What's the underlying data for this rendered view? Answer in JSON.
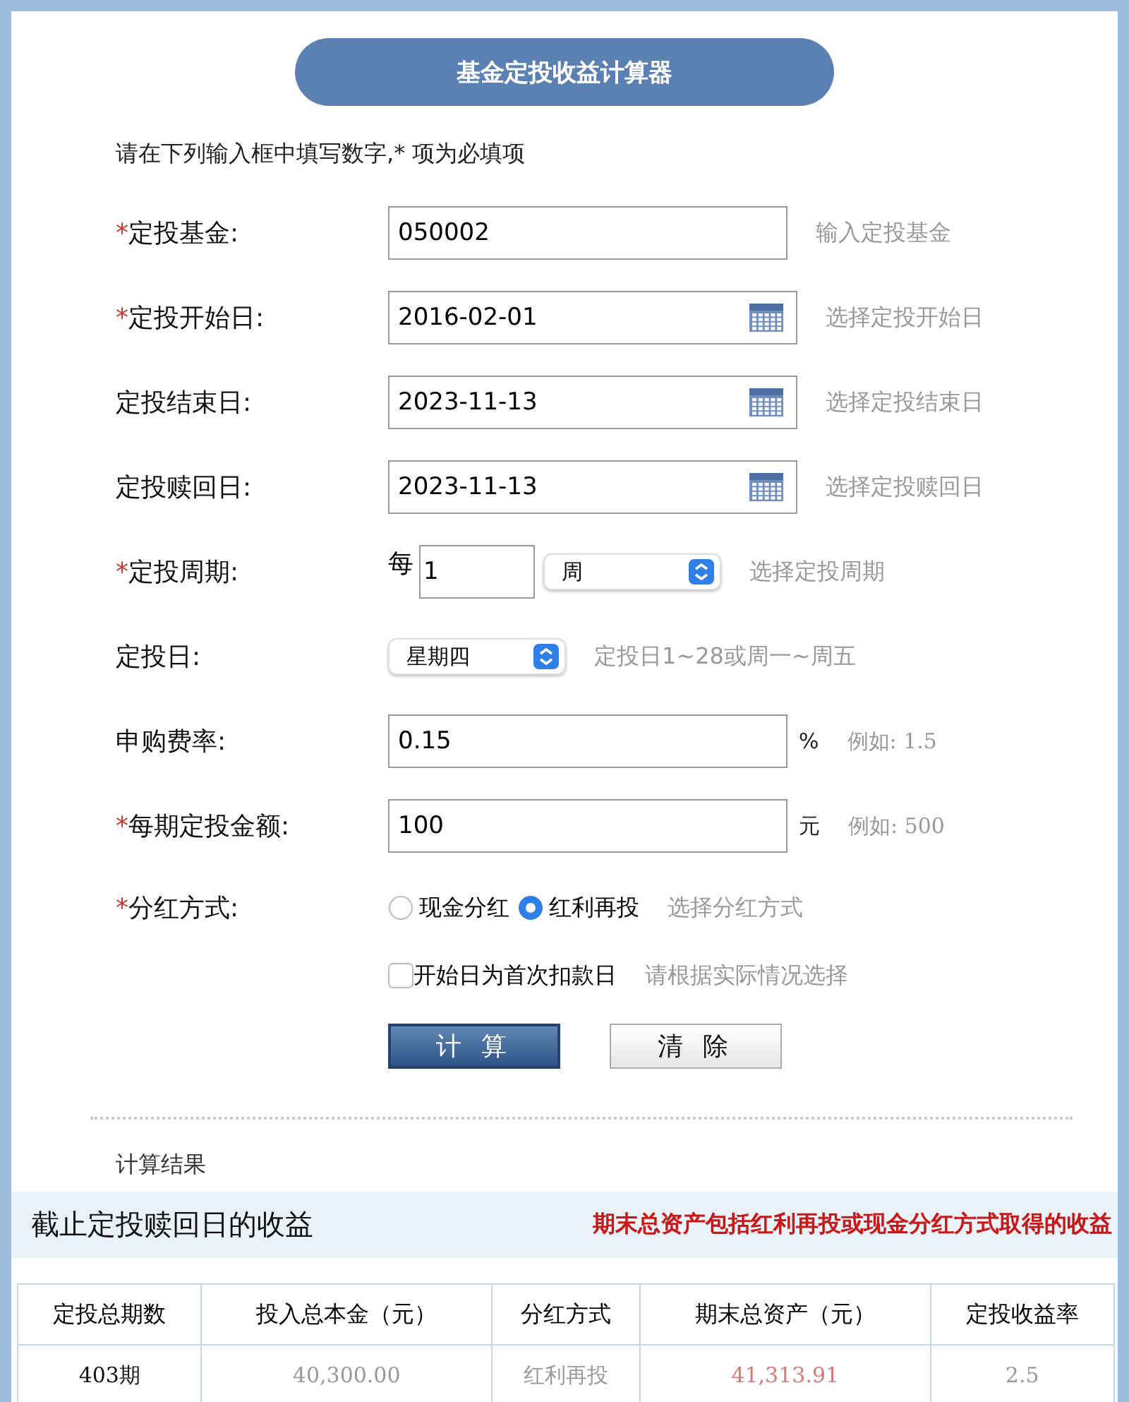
{
  "title": "基金定投收益计算器",
  "instructions": "请在下列输入框中填写数字,* 项为必填项",
  "fields": [
    {
      "kind": "text",
      "star": "*",
      "label": "定投基金:",
      "value": "050002",
      "hint": "输入定投基金"
    },
    {
      "kind": "date",
      "star": "*",
      "label": "定投开始日:",
      "value": "2016-02-01",
      "hint": "选择定投开始日"
    },
    {
      "kind": "date",
      "label": "定投结束日:",
      "value": "2023-11-13",
      "hint": "选择定投结束日"
    },
    {
      "kind": "date",
      "label": "定投赎回日:",
      "value": "2023-11-13",
      "hint": "选择定投赎回日"
    },
    {
      "kind": "period",
      "star": "*",
      "label": "定投周期:",
      "prefix": "每",
      "value": "1",
      "select": "周",
      "hint": "选择定投周期"
    },
    {
      "kind": "select",
      "label": "定投日:",
      "select": "星期四",
      "hint": "定投日1~28或周一~周五"
    },
    {
      "kind": "unit",
      "label": "申购费率:",
      "value": "0.15",
      "unit": "%",
      "hint": "例如: 1.5"
    },
    {
      "kind": "unit",
      "star": "*",
      "label": "每期定投金额:",
      "value": "100",
      "unit": "元",
      "hint": "例如: 500"
    },
    {
      "kind": "radio",
      "star": "*",
      "label": "分红方式:",
      "options": [
        {
          "label": "现金分红",
          "selected": false
        },
        {
          "label": "红利再投",
          "selected": true
        }
      ],
      "hint": "选择分红方式"
    },
    {
      "kind": "checkbox",
      "checked": false,
      "text": "开始日为首次扣款日",
      "hint": "请根据实际情况选择"
    }
  ],
  "buttons": [
    {
      "label": "计 算",
      "primary": true
    },
    {
      "label": "清 除",
      "primary": false
    }
  ],
  "results": {
    "heading": "计算结果",
    "title": "截止定投赎回日的收益",
    "note": "期末总资产包括红利再投或现金分红方式取得的收益",
    "columns": [
      "定投总期数",
      "投入总本金（元）",
      "分红方式",
      "期末总资产（元）",
      "定投收益率"
    ],
    "rows": [
      [
        "403期",
        "40,300.00",
        "红利再投",
        "41,313.91",
        "2.5"
      ]
    ]
  }
}
